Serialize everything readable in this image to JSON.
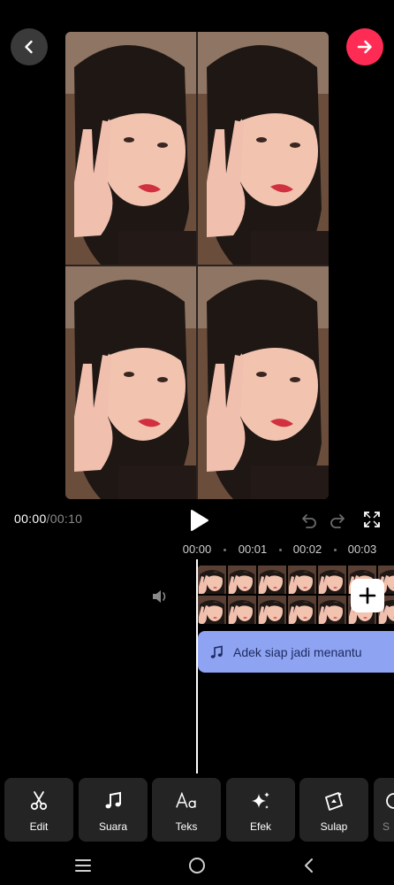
{
  "header": {
    "back_icon": "chevron-left-icon",
    "next_icon": "arrow-right-icon",
    "accent": "#fe2c55"
  },
  "preview": {
    "layout": "2x2 grid",
    "content": "selfie photo, peace sign"
  },
  "playback": {
    "current_time": "00:00",
    "total_time": "/00:10"
  },
  "ruler": {
    "ticks": [
      "00:00",
      "00:01",
      "00:02",
      "00:03"
    ]
  },
  "audio_track": {
    "title": "Adek siap jadi menantu",
    "color": "#8ea3f2"
  },
  "tools": [
    {
      "label": "Edit",
      "icon": "scissors-icon"
    },
    {
      "label": "Suara",
      "icon": "music-note-icon"
    },
    {
      "label": "Teks",
      "icon": "text-aa-icon"
    },
    {
      "label": "Efek",
      "icon": "sparkle-icon"
    },
    {
      "label": "Sulap",
      "icon": "magic-icon"
    },
    {
      "label": "S",
      "icon": "more-tool-icon"
    }
  ]
}
